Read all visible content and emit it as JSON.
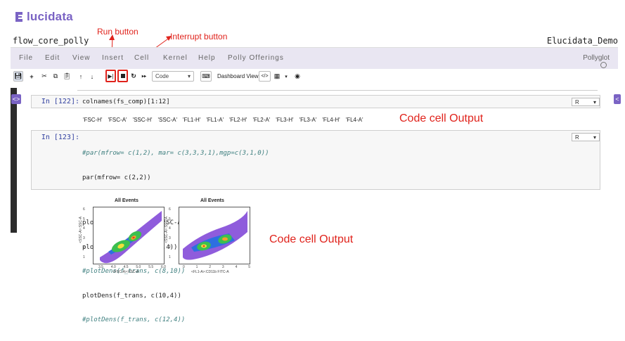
{
  "header": {
    "logo_text": "lucidata",
    "notebook_name": "flow_core_polly",
    "user_name": "Elucidata_Demo"
  },
  "annotations": {
    "run_button": "Run button",
    "interrupt_button": "Interrupt  button",
    "code_cell_output_1": "Code cell Output",
    "code_cell_output_2": "Code cell Output"
  },
  "menubar": {
    "items": [
      "File",
      "Edit",
      "View",
      "Insert",
      "Cell",
      "Kernel",
      "Help",
      "Polly Offerings"
    ],
    "pollyglot": "Pollyglot"
  },
  "toolbar": {
    "cell_type": "Code",
    "dashboard_view_label": "Dashboard View:"
  },
  "cells": [
    {
      "prompt": "In [122]:",
      "code": "colnames(fs_comp)[1:12]",
      "lang": "R",
      "output": [
        "'FSC-H'",
        "'FSC-A'",
        "'SSC-H'",
        "'SSC-A'",
        "'FL1-H'",
        "'FL1-A'",
        "'FL2-H'",
        "'FL2-A'",
        "'FL3-H'",
        "'FL3-A'",
        "'FL4-H'",
        "'FL4-A'"
      ]
    },
    {
      "prompt": "In [123]:",
      "lang": "R",
      "code_lines": [
        "#par(mfrow= c(1,2), mar= c(3,3,3,1),mgp=c(3,1,0))",
        "par(mfrow= c(2,2))",
        "",
        "plotDens(f_trans, c(\"FSC-A\",\"SSC-A\"))",
        "plotDens(f_trans, c(6,4))",
        "#plotDens(f_trans, c(8,10))",
        "plotDens(f_trans, c(10,4))",
        "#plotDens(f_trans, c(12,4))"
      ],
      "plots": [
        {
          "title": "All Events",
          "ylabel": "<SSC-A>:SSC-A",
          "xlabel": "<FSC-A>:FSC-A",
          "xticks": [
            "3.5",
            "4.0",
            "4.5",
            "5.0",
            "5.5",
            "6.0"
          ],
          "yticks": [
            "6",
            "5",
            "4",
            "3",
            "2",
            "1"
          ]
        },
        {
          "title": "All Events",
          "ylabel": "<SSC-A>:SSC-A",
          "xlabel": "<FL1-A>:CD11b FITC-A",
          "xticks": [
            "0",
            "1",
            "2",
            "3",
            "4",
            "5"
          ],
          "yticks": [
            "6",
            "5",
            "4",
            "3",
            "2",
            "1"
          ]
        }
      ]
    }
  ]
}
